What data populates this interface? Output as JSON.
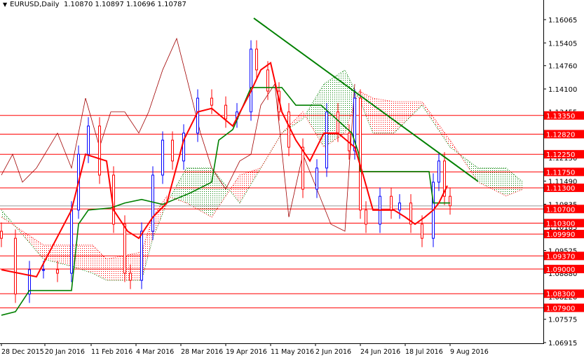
{
  "header": {
    "symbol": "EURUSD,Daily",
    "ohlc": "1.10870 1.10897 1.10696 1.10787"
  },
  "chart_data": {
    "type": "candlestick",
    "title": "EURUSD,Daily",
    "ylim": [
      1.06915,
      1.16065
    ],
    "y_ticks": [
      "1.16065",
      "1.15405",
      "1.14760",
      "1.14100",
      "1.13455",
      "1.12800",
      "1.12150",
      "1.11490",
      "1.10835",
      "1.10185",
      "1.09525",
      "1.08880",
      "1.08220",
      "1.07575",
      "1.06915"
    ],
    "x_ticks": [
      {
        "day": 0,
        "label": "28 Dec 2015"
      },
      {
        "day": 15.5,
        "label": "20 Jan 2016"
      },
      {
        "day": 32,
        "label": "11 Feb 2016"
      },
      {
        "day": 48,
        "label": "4 Mar 2016"
      },
      {
        "day": 64,
        "label": "28 Mar 2016"
      },
      {
        "day": 80,
        "label": "19 Apr 2016"
      },
      {
        "day": 96,
        "label": "11 May 2016"
      },
      {
        "day": 112,
        "label": "2 Jun 2016"
      },
      {
        "day": 128,
        "label": "24 Jun 2016"
      },
      {
        "day": 144,
        "label": "18 Jul 2016"
      },
      {
        "day": 160,
        "label": "9 Aug 2016"
      }
    ],
    "levels": [
      "1.13350",
      "1.12820",
      "1.12250",
      "1.11750",
      "1.11300",
      "1.10700",
      "1.10300",
      "1.09990",
      "1.09370",
      "1.09000",
      "1.08300",
      "1.07900"
    ],
    "current_price": "1.10787",
    "closes": [
      [
        0,
        1.0987
      ],
      [
        5,
        1.0829
      ],
      [
        10,
        1.0898
      ],
      [
        15,
        1.0898
      ],
      [
        20,
        1.0888
      ],
      [
        25,
        1.1067
      ],
      [
        27.5,
        1.1225
      ],
      [
        31,
        1.1305
      ],
      [
        35,
        1.1166
      ],
      [
        40,
        1.1027
      ],
      [
        44,
        1.0888
      ],
      [
        46,
        1.0868
      ],
      [
        50,
        1.1007
      ],
      [
        54,
        1.1166
      ],
      [
        57.5,
        1.1265
      ],
      [
        61,
        1.1206
      ],
      [
        65,
        1.1285
      ],
      [
        70,
        1.1384
      ],
      [
        75,
        1.1364
      ],
      [
        80,
        1.1325
      ],
      [
        84,
        1.1345
      ],
      [
        89,
        1.1523
      ],
      [
        91,
        1.1464
      ],
      [
        95,
        1.1404
      ],
      [
        99,
        1.1345
      ],
      [
        102.5,
        1.1245
      ],
      [
        107.5,
        1.1126
      ],
      [
        112.5,
        1.1186
      ],
      [
        116,
        1.1345
      ],
      [
        120,
        1.1285
      ],
      [
        124,
        1.1235
      ],
      [
        126,
        1.1384
      ],
      [
        128,
        1.1067
      ],
      [
        130,
        1.1027
      ],
      [
        135,
        1.1106
      ],
      [
        139,
        1.1067
      ],
      [
        142,
        1.1087
      ],
      [
        146,
        1.1027
      ],
      [
        150,
        1.0987
      ],
      [
        154,
        1.1146
      ],
      [
        156,
        1.1206
      ],
      [
        158,
        1.1106
      ],
      [
        160,
        1.1079
      ]
    ],
    "tenkan": [
      [
        0,
        1.0898
      ],
      [
        12.5,
        1.0878
      ],
      [
        25,
        1.1067
      ],
      [
        30,
        1.1225
      ],
      [
        37.5,
        1.1206
      ],
      [
        40,
        1.1067
      ],
      [
        45,
        1.1007
      ],
      [
        49,
        1.0987
      ],
      [
        54,
        1.1047
      ],
      [
        59,
        1.1087
      ],
      [
        65,
        1.1265
      ],
      [
        70,
        1.1345
      ],
      [
        75,
        1.1355
      ],
      [
        82.5,
        1.1305
      ],
      [
        89,
        1.1404
      ],
      [
        92.5,
        1.1464
      ],
      [
        96,
        1.1484
      ],
      [
        100,
        1.1345
      ],
      [
        105,
        1.1265
      ],
      [
        110,
        1.1206
      ],
      [
        115,
        1.1285
      ],
      [
        120,
        1.1285
      ],
      [
        126,
        1.1245
      ],
      [
        129,
        1.1166
      ],
      [
        132.5,
        1.1067
      ],
      [
        140,
        1.1067
      ],
      [
        144,
        1.1047
      ],
      [
        147.5,
        1.1027
      ],
      [
        151,
        1.1047
      ],
      [
        154,
        1.1067
      ],
      [
        156,
        1.1087
      ],
      [
        159,
        1.1136
      ]
    ],
    "kijun": [
      [
        0,
        1.0769
      ],
      [
        5,
        1.0779
      ],
      [
        10,
        1.0839
      ],
      [
        25,
        1.0839
      ],
      [
        27.5,
        1.1027
      ],
      [
        31,
        1.1067
      ],
      [
        39,
        1.1073
      ],
      [
        44,
        1.1087
      ],
      [
        50,
        1.1097
      ],
      [
        57.5,
        1.1083
      ],
      [
        67.5,
        1.1116
      ],
      [
        75,
        1.1146
      ],
      [
        77.5,
        1.1265
      ],
      [
        82.5,
        1.1295
      ],
      [
        89,
        1.1414
      ],
      [
        100,
        1.1414
      ],
      [
        105,
        1.1364
      ],
      [
        110,
        1.1364
      ],
      [
        114,
        1.1364
      ],
      [
        125,
        1.1285
      ],
      [
        127.5,
        1.1225
      ],
      [
        128,
        1.1176
      ],
      [
        135,
        1.1176
      ],
      [
        152.5,
        1.1176
      ],
      [
        154,
        1.1087
      ],
      [
        160,
        1.1087
      ]
    ],
    "chikou": [
      [
        0,
        1.1166
      ],
      [
        4,
        1.1225
      ],
      [
        7.5,
        1.1146
      ],
      [
        12.5,
        1.1186
      ],
      [
        20,
        1.1285
      ],
      [
        25,
        1.1186
      ],
      [
        30,
        1.1384
      ],
      [
        35,
        1.1245
      ],
      [
        39,
        1.1345
      ],
      [
        44,
        1.1345
      ],
      [
        49,
        1.1285
      ],
      [
        52.5,
        1.1345
      ],
      [
        57.5,
        1.1464
      ],
      [
        62.5,
        1.1553
      ],
      [
        66,
        1.1444
      ],
      [
        71,
        1.1285
      ],
      [
        75,
        1.1186
      ],
      [
        80,
        1.1126
      ],
      [
        85,
        1.1206
      ],
      [
        89,
        1.1225
      ],
      [
        92.5,
        1.1364
      ],
      [
        97.5,
        1.1424
      ],
      [
        102.5,
        1.1047
      ],
      [
        107.5,
        1.1225
      ],
      [
        112.5,
        1.1126
      ],
      [
        117.5,
        1.1027
      ],
      [
        122.5,
        1.1007
      ],
      [
        126,
        1.1424
      ]
    ],
    "senkou_a": [
      [
        0,
        1.1067
      ],
      [
        15,
        1.0928
      ],
      [
        25,
        1.0908
      ],
      [
        32.5,
        1.0888
      ],
      [
        37.5,
        1.0868
      ],
      [
        50,
        1.0868
      ],
      [
        54,
        1.0987
      ],
      [
        59,
        1.1087
      ],
      [
        66,
        1.1186
      ],
      [
        75,
        1.1186
      ],
      [
        85,
        1.1087
      ],
      [
        92.5,
        1.1186
      ],
      [
        100,
        1.1285
      ],
      [
        107.5,
        1.1325
      ],
      [
        115,
        1.1424
      ],
      [
        122.5,
        1.1464
      ],
      [
        127.5,
        1.1384
      ],
      [
        132.5,
        1.1285
      ],
      [
        140,
        1.1285
      ],
      [
        150,
        1.1364
      ],
      [
        160,
        1.1245
      ],
      [
        170,
        1.1186
      ],
      [
        180,
        1.1186
      ],
      [
        186,
        1.1146
      ]
    ],
    "senkou_b": [
      [
        0,
        1.1047
      ],
      [
        15,
        1.0968
      ],
      [
        25,
        1.0968
      ],
      [
        32.5,
        1.0968
      ],
      [
        37.5,
        1.0928
      ],
      [
        50,
        1.0948
      ],
      [
        54,
        1.1047
      ],
      [
        59,
        1.1107
      ],
      [
        66,
        1.1087
      ],
      [
        75,
        1.1047
      ],
      [
        85,
        1.1166
      ],
      [
        92.5,
        1.1186
      ],
      [
        100,
        1.1285
      ],
      [
        107.5,
        1.1345
      ],
      [
        115,
        1.1245
      ],
      [
        122.5,
        1.1285
      ],
      [
        127.5,
        1.1404
      ],
      [
        132.5,
        1.1384
      ],
      [
        140,
        1.1374
      ],
      [
        150,
        1.1374
      ],
      [
        160,
        1.1265
      ],
      [
        170,
        1.1146
      ],
      [
        180,
        1.1107
      ],
      [
        186,
        1.1126
      ]
    ],
    "trendline": [
      [
        90,
        1.16105
      ],
      [
        170,
        1.1148
      ]
    ]
  },
  "colors": {
    "up": "#0000ff",
    "down": "#ff0000",
    "tenkan": "#ff0000",
    "kijun": "#008000",
    "chikou": "#a00000",
    "cloud_bull": "#008000",
    "cloud_bear": "#ff0000",
    "level": "#ff0000",
    "trend": "#008000"
  }
}
